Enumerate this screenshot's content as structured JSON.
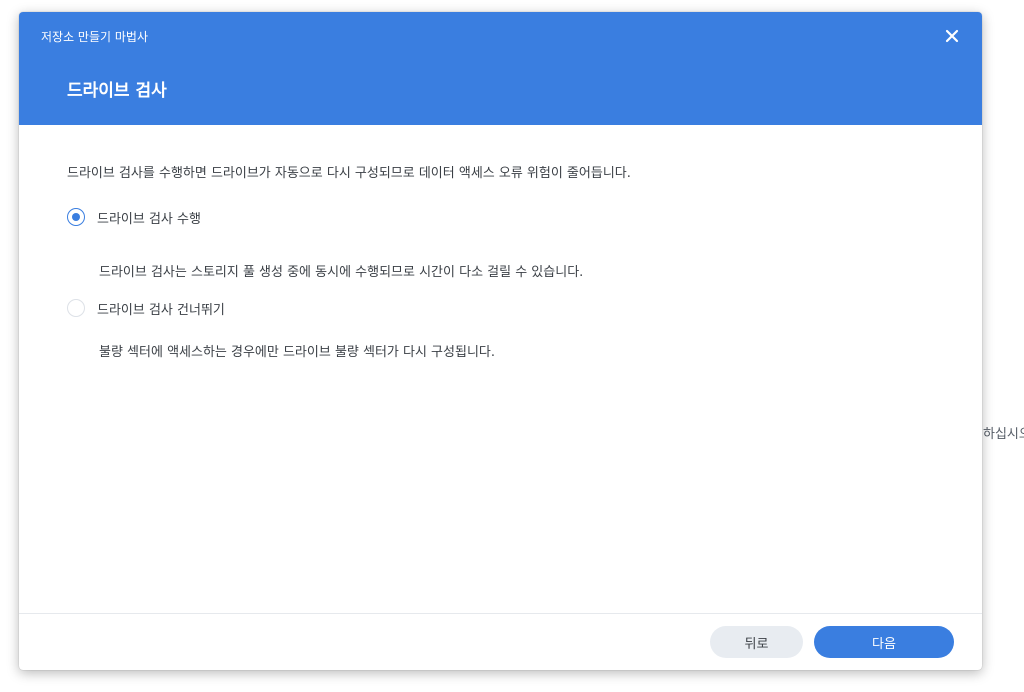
{
  "background": {
    "partial_text": "하십시오"
  },
  "dialog": {
    "wizard_title": "저장소 만들기 마법사",
    "step_title": "드라이브 검사",
    "intro": "드라이브 검사를 수행하면 드라이브가 자동으로 다시 구성되므로 데이터 액세스 오류 위험이 줄어듭니다.",
    "options": [
      {
        "label": "드라이브 검사 수행",
        "description": "드라이브 검사는 스토리지 풀 생성 중에 동시에 수행되므로 시간이 다소 걸릴 수 있습니다.",
        "selected": true
      },
      {
        "label": "드라이브 검사 건너뛰기",
        "description": "불량 섹터에 액세스하는 경우에만 드라이브 불량 섹터가 다시 구성됩니다.",
        "selected": false
      }
    ],
    "buttons": {
      "back": "뒤로",
      "next": "다음"
    },
    "colors": {
      "accent": "#3a7ee0",
      "text": "#3a3f45",
      "secondary_button": "#e8ecf1"
    },
    "icons": {
      "close": "close-icon"
    }
  }
}
